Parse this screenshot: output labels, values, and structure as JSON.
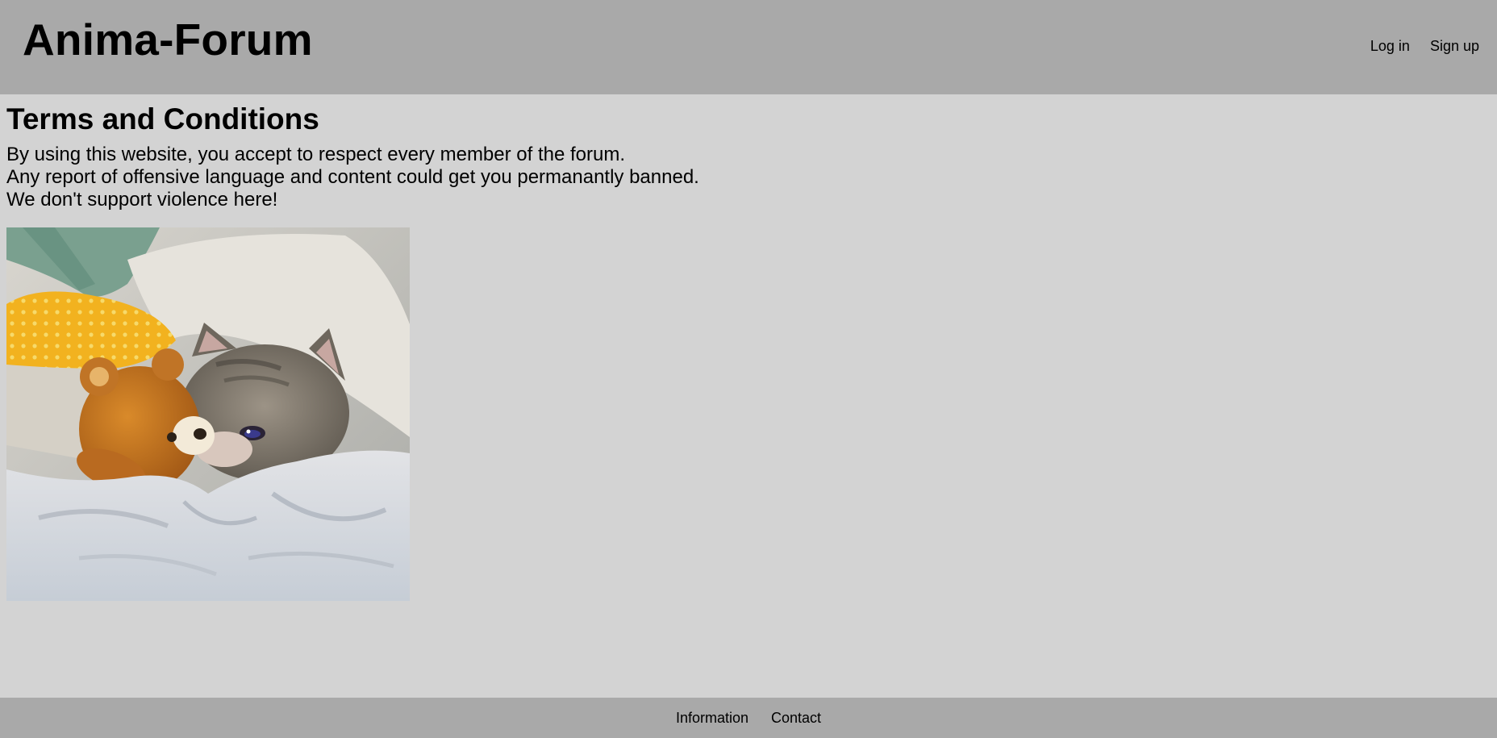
{
  "header": {
    "site_title": "Anima-Forum",
    "nav": {
      "login_label": "Log in",
      "signup_label": "Sign up"
    }
  },
  "main": {
    "heading": "Terms and Conditions",
    "terms_lines": [
      "By using this website, you accept to respect every member of the forum.",
      "Any report of offensive language and content could get you permanantly banned.",
      "We don't support violence here!"
    ],
    "image_subject": "crying cat lying in bed next to an orange teddy bear"
  },
  "footer": {
    "information_label": "Information",
    "contact_label": "Contact"
  },
  "colors": {
    "header_bg": "#a9a9a9",
    "page_bg": "#d3d3d3",
    "footer_bg": "#a9a9a9",
    "text": "#000000"
  }
}
